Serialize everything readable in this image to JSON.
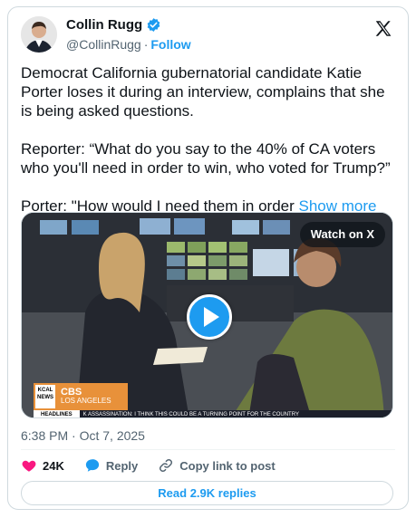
{
  "author": {
    "name": "Collin Rugg",
    "handle": "@CollinRugg",
    "separator": "·",
    "follow_label": "Follow"
  },
  "tweet": {
    "text": "Democrat California gubernatorial candidate Katie Porter loses it during an interview, complains that she is being asked questions.\n\nReporter: “What do you say to the 40% of CA voters who you'll need in order to win, who voted for Trump?”\n\nPorter: \"How would I need them in order ",
    "show_more": "Show more"
  },
  "media": {
    "watch_label": "Watch on X",
    "kcal_label": "KCAL NEWS",
    "cbs_label": "CBS",
    "cbs_sublabel": "LOS ANGELES",
    "ticker_headline": "HEADLINES",
    "ticker_text": "K ASSASSINATION: I THINK THIS COULD BE A TURNING POINT FOR THE COUNTRY"
  },
  "meta": {
    "timestamp": "6:38 PM · Oct 7, 2025"
  },
  "actions": {
    "likes": "24K",
    "reply": "Reply",
    "copy_link": "Copy link to post"
  },
  "read_replies": "Read 2.9K replies",
  "colors": {
    "accent": "#1d9bf0",
    "like": "#f91880",
    "text": "#0f1419",
    "muted": "#536471"
  }
}
